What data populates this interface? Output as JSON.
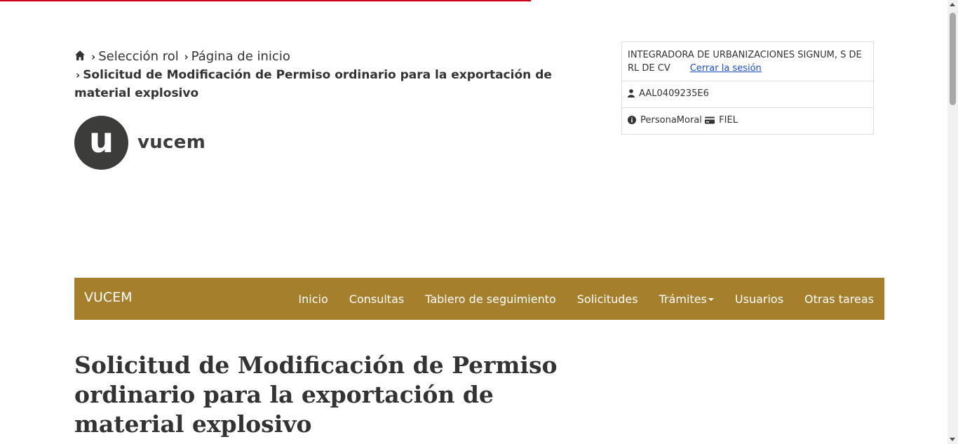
{
  "colors": {
    "accent": "#a57f2c",
    "top_bar": "#d0021b",
    "link": "#1a4fcf",
    "text": "#333333"
  },
  "breadcrumb": {
    "home_icon": "home-icon",
    "items": [
      "Selección rol",
      "Página de inicio"
    ],
    "current": "Solicitud de Modificación de Permiso ordinario para la exportación de material explosivo"
  },
  "logo": {
    "letter": "u",
    "name": "vucem"
  },
  "user": {
    "company": "INTEGRADORA DE URBANIZACIONES SIGNUM, S DE RL DE CV",
    "logout_label": "Cerrar la sesión",
    "rfc": "AAL0409235E6",
    "person_type": "PersonaMoral",
    "cert_type": "FIEL"
  },
  "navbar": {
    "brand": "VUCEM",
    "items": [
      "Inicio",
      "Consultas",
      "Tablero de seguimiento",
      "Solicitudes",
      "Trámites",
      "Usuarios",
      "Otras tareas"
    ]
  },
  "page": {
    "title": "Solicitud de Modificación de Permiso ordinario para la exportación de material explosivo"
  }
}
